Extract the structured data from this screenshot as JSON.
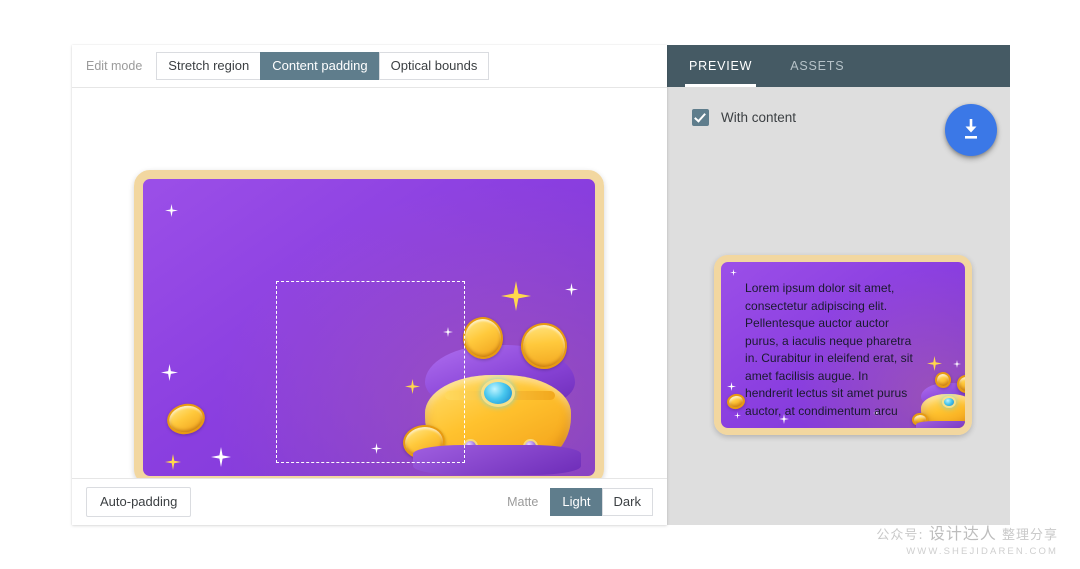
{
  "editor": {
    "edit_mode_label": "Edit mode",
    "modes": [
      {
        "label": "Stretch region",
        "active": false
      },
      {
        "label": "Content padding",
        "active": true
      },
      {
        "label": "Optical bounds",
        "active": false
      }
    ],
    "auto_padding_label": "Auto-padding",
    "matte_label": "Matte",
    "matte_options": [
      {
        "label": "Light",
        "active": true
      },
      {
        "label": "Dark",
        "active": false
      }
    ]
  },
  "preview": {
    "tabs": [
      {
        "label": "PREVIEW",
        "active": true
      },
      {
        "label": "ASSETS",
        "active": false
      }
    ],
    "with_content_label": "With content",
    "with_content_checked": true,
    "download_icon": "download-icon",
    "result_text": "Lorem ipsum dolor sit amet, consectetur adipiscing elit. Pellentesque auctor auctor purus, a iaculis neque pharetra in. Curabitur in eleifend erat, sit amet facilisis augue. In hendrerit lectus sit amet purus auctor, at condimentum arcu"
  },
  "watermark": {
    "line1_prefix": "公众号: ",
    "line1_brand": "设计达人",
    "line1_suffix": " 整理分享",
    "line2": "WWW.SHEJIDAREN.COM"
  },
  "colors": {
    "accent_blue": "#3b78e7",
    "slate": "#5f7d8c",
    "tab_bar": "#455a64",
    "panel_bg": "#dedede",
    "card_purple": "#8b3fe0",
    "card_gold": "#f2d7a0"
  }
}
